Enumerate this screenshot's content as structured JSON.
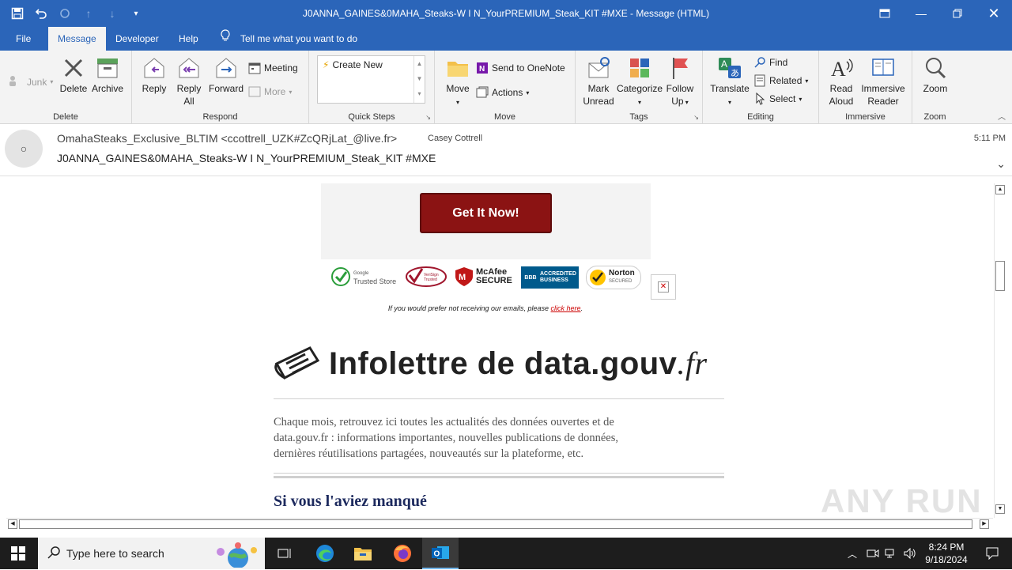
{
  "window": {
    "title": "J0ANNA_GAINES&0MAHA_Steaks-W I N_YourPREMIUM_Steak_KIT #MXE  -  Message (HTML)"
  },
  "tabs": [
    "File",
    "Message",
    "Developer",
    "Help"
  ],
  "tell_me": "Tell me what you want to do",
  "ribbon": {
    "delete_group": {
      "junk": "Junk",
      "delete": "Delete",
      "archive": "Archive",
      "label": "Delete"
    },
    "respond_group": {
      "reply": "Reply",
      "reply_all_1": "Reply",
      "reply_all_2": "All",
      "forward": "Forward",
      "meeting": "Meeting",
      "more": "More",
      "label": "Respond"
    },
    "quick_steps": {
      "create_new": "Create New",
      "label": "Quick Steps"
    },
    "move_group": {
      "move": "Move",
      "onenote": "Send to OneNote",
      "actions": "Actions",
      "label": "Move"
    },
    "tags_group": {
      "mark_unread_1": "Mark",
      "mark_unread_2": "Unread",
      "categorize": "Categorize",
      "follow_up_1": "Follow",
      "follow_up_2": "Up",
      "label": "Tags"
    },
    "editing_group": {
      "translate": "Translate",
      "find": "Find",
      "related": "Related",
      "select": "Select",
      "label": "Editing"
    },
    "immersive_group": {
      "read_aloud_1": "Read",
      "read_aloud_2": "Aloud",
      "immersive_reader_1": "Immersive",
      "immersive_reader_2": "Reader",
      "label": "Immersive"
    },
    "zoom_group": {
      "zoom": "Zoom",
      "label": "Zoom"
    }
  },
  "message": {
    "from": "OmahaSteaks_Exclusive_BLTIM <ccottrell_UZK#ZcQRjLat_@live.fr>",
    "to": "Casey Cottrell",
    "subject": "J0ANNA_GAINES&0MAHA_Steaks-W I N_YourPREMIUM_Steak_KIT  #MXE",
    "time": "5:11 PM"
  },
  "body": {
    "cta": "Get It Now!",
    "badges": {
      "trusted_store_small": "Google",
      "trusted_store": "Trusted Store",
      "verisign": "VeriSign Trusted",
      "mcafee_1": "McAfee",
      "mcafee_2": "SECURE",
      "bbb_1": "ACCREDITED",
      "bbb_2": "BUSINESS",
      "bbb_logo": "BBB",
      "norton_1": "Norton",
      "norton_2": "SECURED"
    },
    "unsubscribe_text": "If you would prefer not receiving our emails, please ",
    "unsubscribe_link": "click here",
    "unsubscribe_end": ".",
    "newsletter_title_1": "Infolettre de data.gouv",
    "newsletter_title_2": ".fr",
    "intro_1": "Chaque mois, retrouvez ici toutes les actualités des données ouvertes et de",
    "intro_2": "data.gouv.fr : informations importantes, nouvelles publications de données,",
    "intro_3": "dernières réutilisations partagées, nouveautés sur la plateforme, etc.",
    "section_title": "Si vous l'aviez manqué"
  },
  "watermark": "ANY RUN",
  "taskbar": {
    "search_placeholder": "Type here to search",
    "time": "8:24 PM",
    "date": "9/18/2024"
  }
}
